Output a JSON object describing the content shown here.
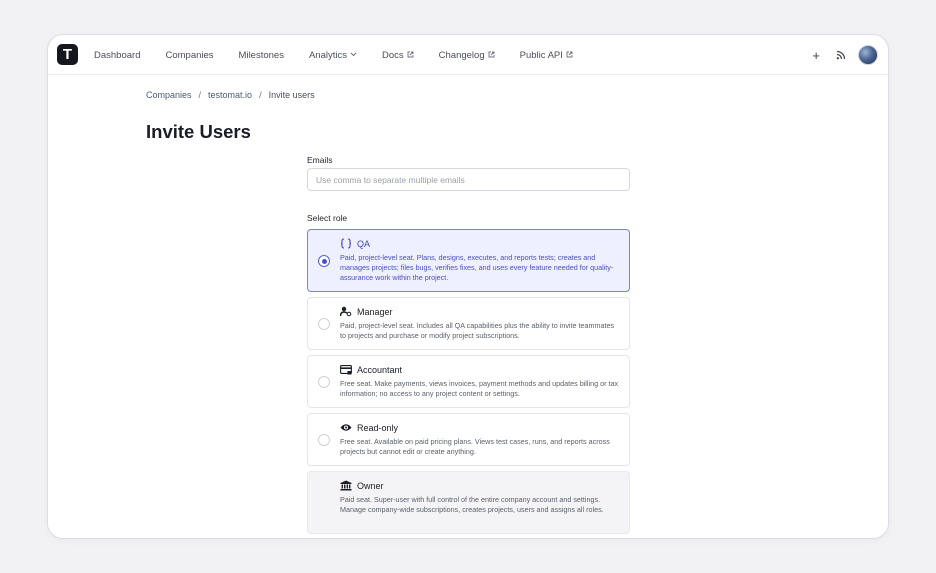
{
  "logo": {
    "letter": "T"
  },
  "nav": {
    "items": [
      {
        "label": "Dashboard",
        "external": false,
        "dropdown": false
      },
      {
        "label": "Companies",
        "external": false,
        "dropdown": false
      },
      {
        "label": "Milestones",
        "external": false,
        "dropdown": false
      },
      {
        "label": "Analytics",
        "external": false,
        "dropdown": true
      },
      {
        "label": "Docs",
        "external": true,
        "dropdown": false
      },
      {
        "label": "Changelog",
        "external": true,
        "dropdown": false
      },
      {
        "label": "Public API",
        "external": true,
        "dropdown": false
      }
    ],
    "plus_label": "+"
  },
  "breadcrumb": {
    "root": "Companies",
    "company": "testomat.io",
    "current": "Invite users",
    "separator": "/"
  },
  "page": {
    "title": "Invite Users"
  },
  "form": {
    "emails_label": "Emails",
    "emails_placeholder": "Use comma to separate multiple emails",
    "emails_value": "",
    "role_label": "Select role",
    "selected_role": "QA",
    "roles": [
      {
        "name": "QA",
        "icon": "code-braces-icon",
        "description": "Paid, project-level seat. Plans, designs, executes, and reports tests; creates and manages projects; files bugs, verifies fixes, and uses every feature needed for quality-assurance work within the project."
      },
      {
        "name": "Manager",
        "icon": "user-gear-icon",
        "description": "Paid, project-level seat. Includes all QA capabilities plus the ability to invite teammates to projects and purchase or modify project subscriptions."
      },
      {
        "name": "Accountant",
        "icon": "credit-card-icon",
        "description": "Free seat. Make payments, views invoices, payment methods and updates billing or tax information; no access to any project content or settings."
      },
      {
        "name": "Read-only",
        "icon": "eye-icon",
        "description": "Free seat. Available on paid pricing plans. Views test cases, runs, and reports across projects but cannot edit or create anything."
      },
      {
        "name": "Owner",
        "icon": "bank-icon",
        "description": "Paid seat. Super-user with full control of the entire company account and settings. Manage company-wide subscriptions, creates projects, users and assigns all roles."
      }
    ]
  },
  "colors": {
    "accent": "#4a50d4",
    "selected_bg": "#eef0fd",
    "selected_border": "#7b80e8"
  }
}
